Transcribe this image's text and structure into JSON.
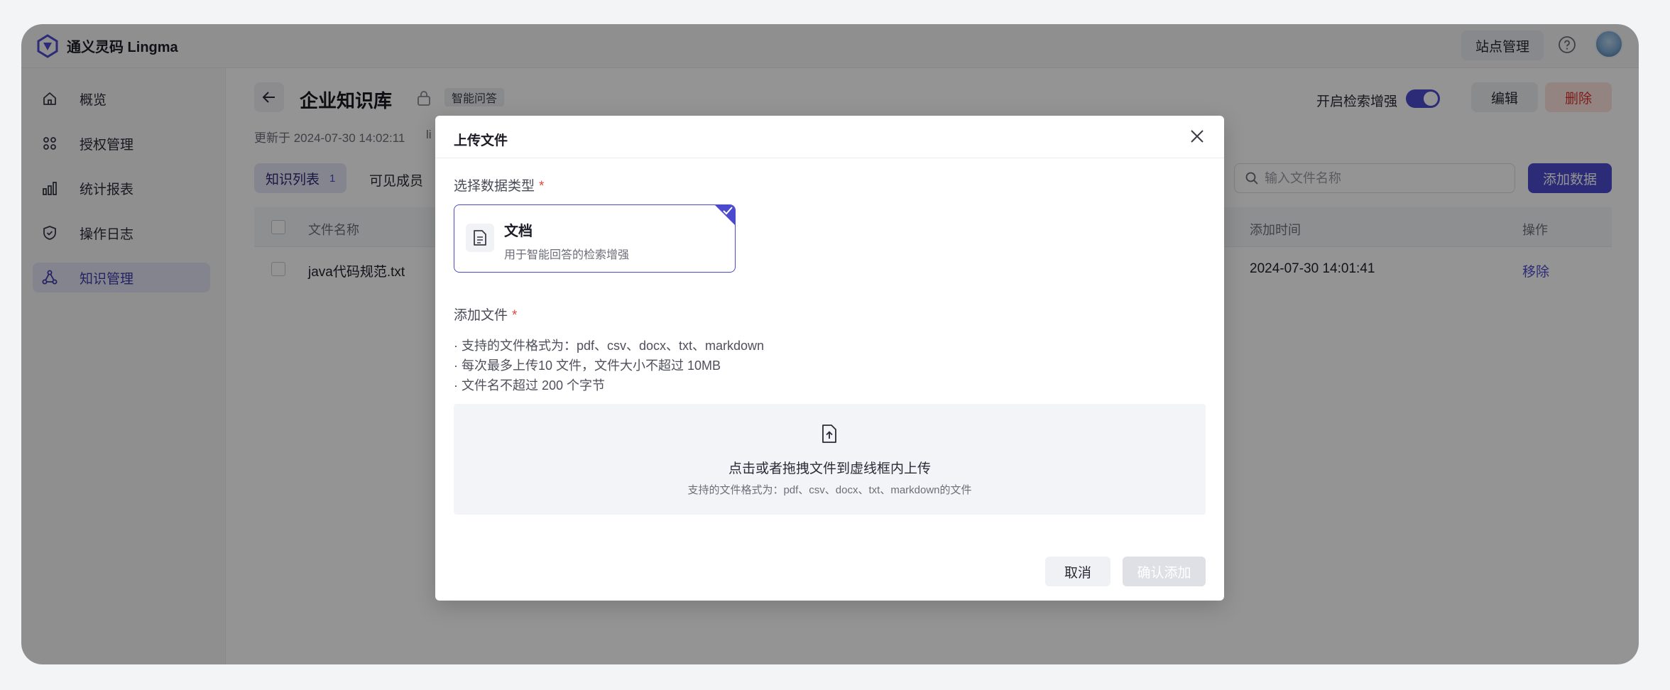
{
  "app": {
    "title": "通义灵码 Lingma",
    "accent": "#4b4acf",
    "danger": "#d8322b"
  },
  "topbar": {
    "site_manage": "站点管理",
    "help_icon": "question-circle-icon",
    "avatar_icon": "user-avatar"
  },
  "sidebar": {
    "items": [
      {
        "label": "概览",
        "icon": "home-icon"
      },
      {
        "label": "授权管理",
        "icon": "grid-icon"
      },
      {
        "label": "统计报表",
        "icon": "bar-chart-icon"
      },
      {
        "label": "操作日志",
        "icon": "shield-icon"
      },
      {
        "label": "知识管理",
        "icon": "network-icon",
        "active": true
      }
    ]
  },
  "kb": {
    "title": "企业知识库",
    "tag": "智能问答",
    "updated": "更新于 2024-07-30 14:02:11",
    "updated_extra": "li",
    "toggle_label": "开启检索增强",
    "toggle_on": true,
    "edit": "编辑",
    "delete": "删除",
    "tabs": {
      "list_label": "知识列表",
      "list_count": "1",
      "members_label": "可见成员"
    },
    "search_placeholder": "输入文件名称",
    "add_data": "添加数据",
    "table": {
      "columns": {
        "name": "文件名称",
        "time": "添加时间",
        "op": "操作"
      },
      "rows": [
        {
          "name": "java代码规范.txt",
          "time": "2024-07-30 14:01:41",
          "op": "移除"
        }
      ]
    }
  },
  "modal": {
    "title": "上传文件",
    "type_label": "选择数据类型",
    "required_mark": "*",
    "card": {
      "title": "文档",
      "desc": "用于智能回答的检索增强"
    },
    "file_label": "添加文件",
    "rules": [
      "· 支持的文件格式为：pdf、csv、docx、txt、markdown",
      "· 每次最多上传10 文件，文件大小不超过 10MB",
      "· 文件名不超过 200 个字节"
    ],
    "dropzone_main": "点击或者拖拽文件到虚线框内上传",
    "dropzone_sub": "支持的文件格式为：pdf、csv、docx、txt、markdown的文件",
    "cancel": "取消",
    "confirm": "确认添加"
  }
}
